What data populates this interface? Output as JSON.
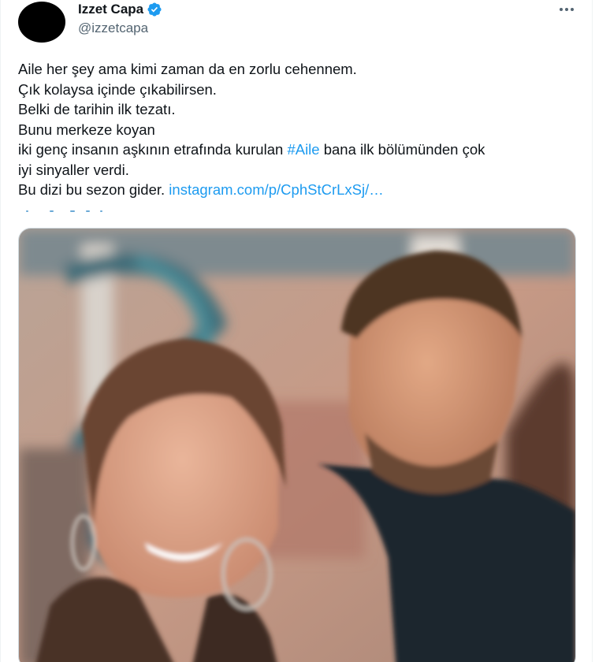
{
  "author": {
    "display_name": "Izzet Capa",
    "handle": "@izzetcapa",
    "verified": true
  },
  "icons": {
    "verified": "verified-badge-icon",
    "more": "more-options-icon"
  },
  "tweet": {
    "lines": [
      "Aile her şey ama kimi zaman da en zorlu cehennem.",
      "Çık kolaysa içinde çıkabilirsen.",
      "Belki de tarihin ilk tezatı.",
      "Bunu merkeze koyan"
    ],
    "line5_before": "iki genç insanın aşkının etrafında kurulan ",
    "hashtag": "#Aile",
    "line5_after": " bana ilk bölümünden çok",
    "line6": "iyi sinyaller verdi.",
    "line7_before": "Bu dizi bu sezon gider. ",
    "link": "instagram.com/p/CphStCrLxSj/…"
  },
  "colors": {
    "link": "#1d9bf0",
    "secondary_text": "#536471",
    "verified_badge": "#1d9bf0"
  }
}
